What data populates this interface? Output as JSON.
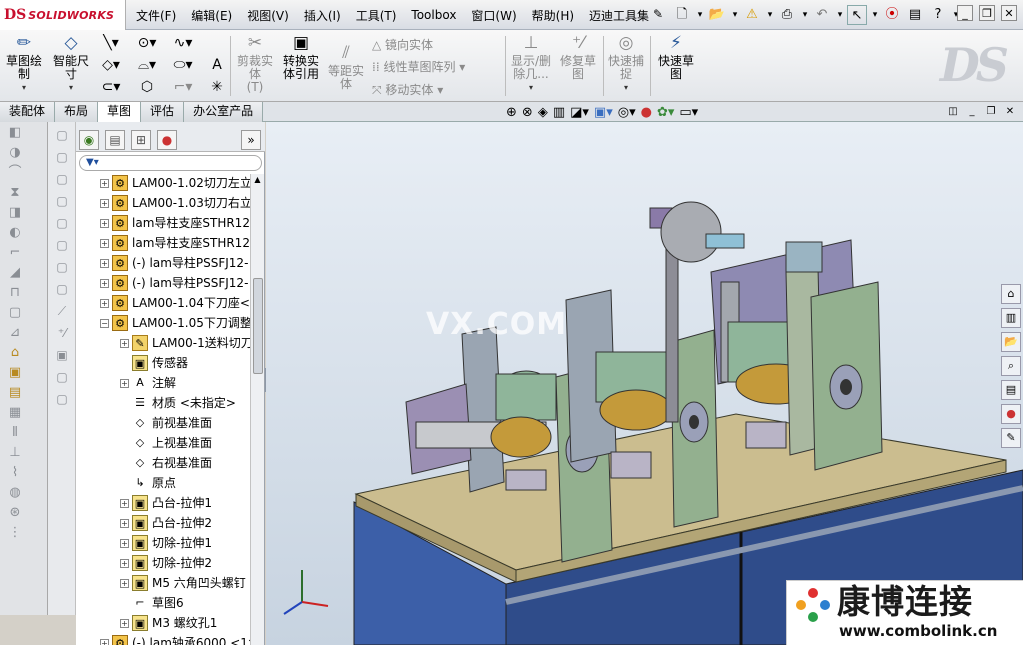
{
  "app": {
    "logo_ds": "DS",
    "logo_text": "SOLIDWORKS"
  },
  "menu": [
    "文件(F)",
    "编辑(E)",
    "视图(V)",
    "插入(I)",
    "工具(T)",
    "Toolbox",
    "窗口(W)",
    "帮助(H)",
    "迈迪工具集"
  ],
  "command_manager": {
    "sketch": "草图绘制",
    "smart_dim": "智能尺寸",
    "trim": "剪裁实体",
    "trim_sub": "(T)",
    "convert": "转换实体引用",
    "offset": "等距实体",
    "mirror": "镜向实体",
    "pattern": "线性草图阵列",
    "move": "移动实体",
    "show_delete": "显示/删除几...",
    "repair": "修复草图",
    "quick_snap": "快速捕捉",
    "rapid_sketch": "快速草图"
  },
  "tabs": [
    "装配体",
    "布局",
    "草图",
    "评估",
    "办公室产品"
  ],
  "active_tab": 2,
  "tree": [
    {
      "label": "LAM00-1.02切刀左立",
      "icon": "asm",
      "level": 0,
      "expander": "+"
    },
    {
      "label": "LAM00-1.03切刀右立",
      "icon": "asm",
      "level": 0,
      "expander": "+"
    },
    {
      "label": "lam导柱支座STHR12",
      "icon": "asm",
      "level": 0,
      "expander": "+"
    },
    {
      "label": "lam导柱支座STHR12",
      "icon": "asm",
      "level": 0,
      "expander": "+"
    },
    {
      "label": "(-) lam导柱PSSFJ12-",
      "icon": "asm",
      "level": 0,
      "expander": "+"
    },
    {
      "label": "(-) lam导柱PSSFJ12-",
      "icon": "asm",
      "level": 0,
      "expander": "+"
    },
    {
      "label": "LAM00-1.04下刀座<",
      "icon": "asm",
      "level": 0,
      "expander": "+"
    },
    {
      "label": "LAM00-1.05下刀调整",
      "icon": "asm",
      "level": 0,
      "expander": "−"
    },
    {
      "label": "LAM00-1送料切刀",
      "icon": "part",
      "level": 1,
      "expander": "+"
    },
    {
      "label": "传感器",
      "icon": "feat",
      "level": 1,
      "expander": ""
    },
    {
      "label": "注解",
      "icon": "note",
      "level": 1,
      "expander": "+"
    },
    {
      "label": "材质 <未指定>",
      "icon": "mat",
      "level": 1,
      "expander": ""
    },
    {
      "label": "前视基准面",
      "icon": "plane",
      "level": 1,
      "expander": ""
    },
    {
      "label": "上视基准面",
      "icon": "plane",
      "level": 1,
      "expander": ""
    },
    {
      "label": "右视基准面",
      "icon": "plane",
      "level": 1,
      "expander": ""
    },
    {
      "label": "原点",
      "icon": "origin",
      "level": 1,
      "expander": ""
    },
    {
      "label": "凸台-拉伸1",
      "icon": "feat",
      "level": 1,
      "expander": "+"
    },
    {
      "label": "凸台-拉伸2",
      "icon": "feat",
      "level": 1,
      "expander": "+"
    },
    {
      "label": "切除-拉伸1",
      "icon": "feat",
      "level": 1,
      "expander": "+"
    },
    {
      "label": "切除-拉伸2",
      "icon": "feat",
      "level": 1,
      "expander": "+"
    },
    {
      "label": "M5 六角凹头螺钉",
      "icon": "feat",
      "level": 1,
      "expander": "+"
    },
    {
      "label": "草图6",
      "icon": "sketch",
      "level": 1,
      "expander": ""
    },
    {
      "label": "M3 螺纹孔1",
      "icon": "feat",
      "level": 1,
      "expander": "+"
    },
    {
      "label": "(-) lam轴承6000 <1>",
      "icon": "asm",
      "level": 0,
      "expander": "+"
    }
  ],
  "watermark": "VX.COM",
  "brand": {
    "name": "康博连接",
    "url": "www.combolink.cn"
  },
  "colors": {
    "accent": "#c8102e",
    "part_green": "#8fb08a",
    "table_tan": "#c8b88a",
    "cabinet_blue": "#2f4c8a"
  }
}
